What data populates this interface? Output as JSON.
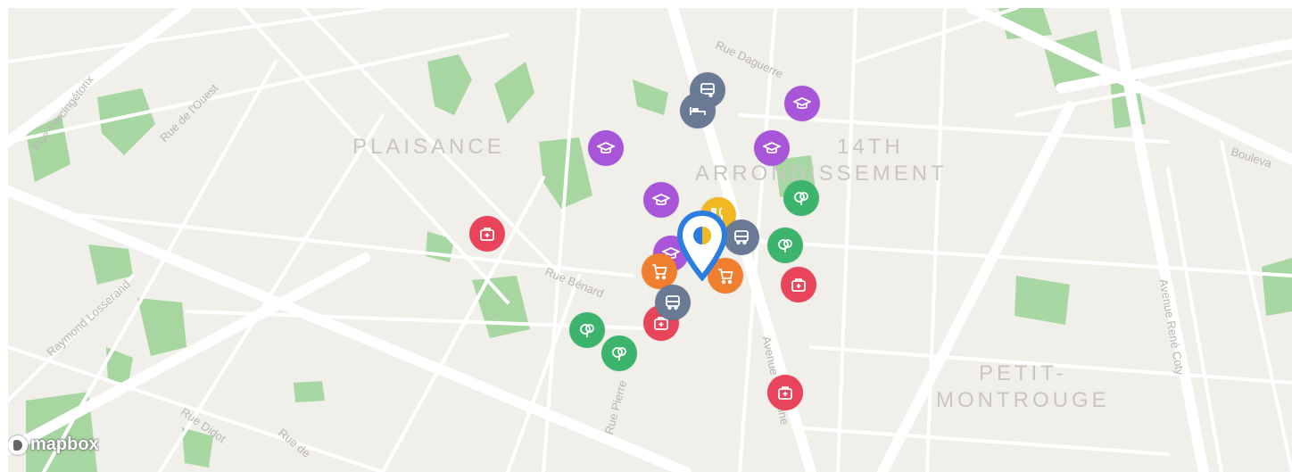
{
  "map": {
    "districts": [
      {
        "key": "plaisance",
        "lines": [
          "PLAISANCE"
        ]
      },
      {
        "key": "arr14",
        "lines": [
          "14TH",
          "ARRONDISSEMENT"
        ]
      },
      {
        "key": "petit_montrouge",
        "lines": [
          "PETIT-",
          "MONTROUGE"
        ]
      }
    ],
    "streets": [
      {
        "key": "vercingetorix",
        "label": "Rue Vercingétorix"
      },
      {
        "key": "ouest",
        "label": "Rue de l'Ouest"
      },
      {
        "key": "bonard",
        "label": "Rue Bénard"
      },
      {
        "key": "raymond_losserand",
        "label": "Raymond Losserand"
      },
      {
        "key": "maine",
        "label": "Avenue du Maine"
      },
      {
        "key": "rene_coty",
        "label": "Avenue René Coty"
      },
      {
        "key": "boulevard",
        "label": "Bouleva"
      },
      {
        "key": "daguerre",
        "label": "Rue Daguerre"
      },
      {
        "key": "pierre_larousse",
        "label": "Rue Pierre"
      },
      {
        "key": "didot",
        "label": "Rue Didot"
      },
      {
        "key": "rue_sud",
        "label": "Rue de"
      }
    ],
    "poi_colors": {
      "education": "#a855d9",
      "transit": "#6b7a94",
      "health": "#e8445a",
      "park": "#3cb46e",
      "shop": "#ef7f2e",
      "food": "#f2b824"
    },
    "pois": [
      {
        "type": "transit",
        "icon": "bus-icon"
      },
      {
        "type": "transit",
        "icon": "bed-icon"
      },
      {
        "type": "education",
        "icon": "graduation-cap-icon"
      },
      {
        "type": "education",
        "icon": "graduation-cap-icon"
      },
      {
        "type": "education",
        "icon": "graduation-cap-icon"
      },
      {
        "type": "education",
        "icon": "graduation-cap-icon"
      },
      {
        "type": "park",
        "icon": "tree-icon"
      },
      {
        "type": "food",
        "icon": "food-icon"
      },
      {
        "type": "health",
        "icon": "first-aid-icon"
      },
      {
        "type": "education",
        "icon": "graduation-cap-icon"
      },
      {
        "type": "transit",
        "icon": "bus-icon"
      },
      {
        "type": "park",
        "icon": "tree-icon"
      },
      {
        "type": "shop",
        "icon": "cart-icon"
      },
      {
        "type": "shop",
        "icon": "cart-icon"
      },
      {
        "type": "health",
        "icon": "first-aid-icon"
      },
      {
        "type": "health",
        "icon": "first-aid-icon"
      },
      {
        "type": "transit",
        "icon": "bus-icon"
      },
      {
        "type": "park",
        "icon": "tree-icon"
      },
      {
        "type": "park",
        "icon": "tree-icon"
      },
      {
        "type": "health",
        "icon": "first-aid-icon"
      }
    ],
    "selected_pin": {
      "icon": "location-pin-icon",
      "color": "#2a7de1"
    },
    "attribution": {
      "logo_text": "mapbox"
    }
  }
}
